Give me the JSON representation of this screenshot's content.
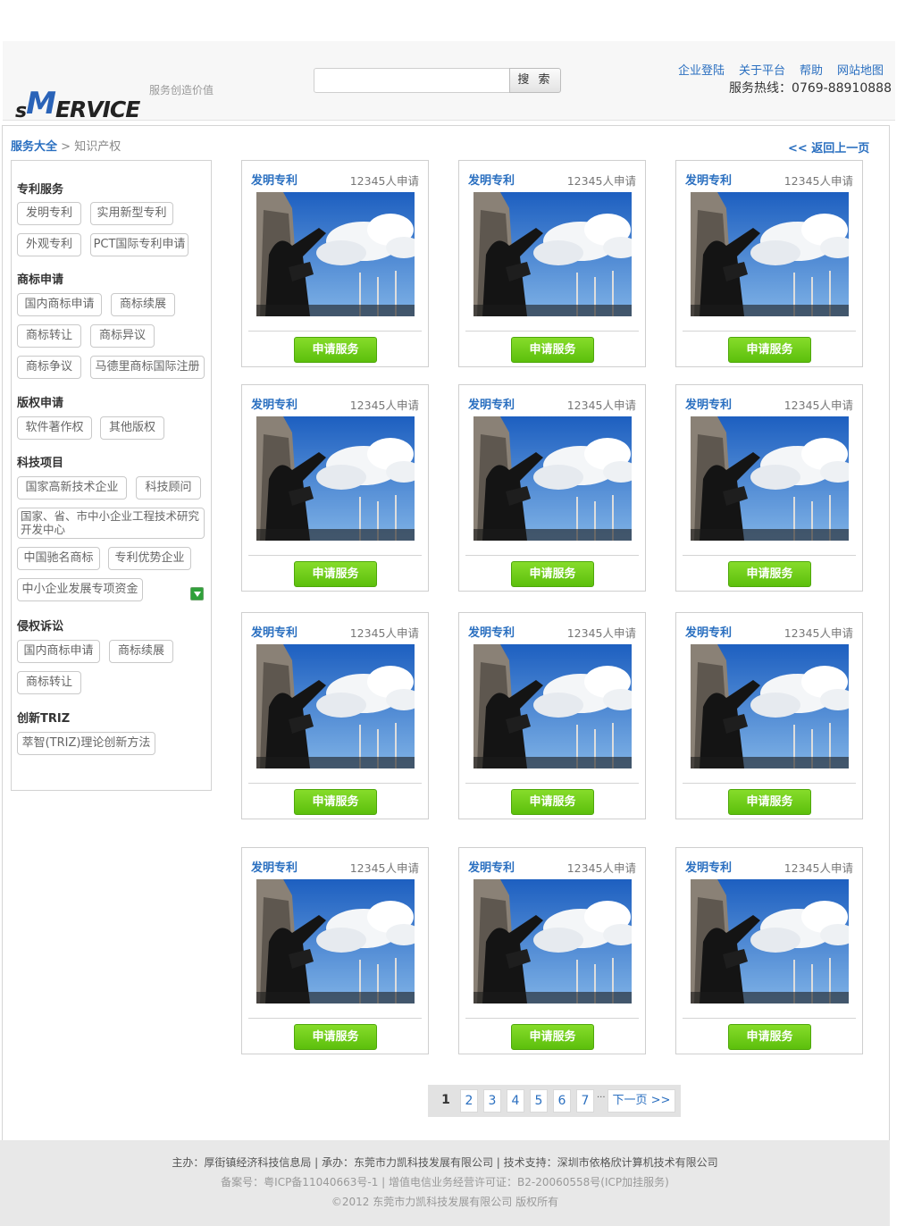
{
  "header": {
    "slogan": "服务创造价值",
    "logo_s": "s",
    "logo_m": "M",
    "logo_rest": "ERVICE",
    "search": {
      "placeholder": "",
      "button_label": "搜 索"
    },
    "links": [
      "企业登陆",
      "关于平台",
      "帮助",
      "网站地图"
    ],
    "hotline": "服务热线：0769-88910888"
  },
  "breadcrumb": {
    "home": "服务大全",
    "separator": " > ",
    "current": "知识产权"
  },
  "back_link": "<< 返回上一页",
  "sidebar": {
    "categories": [
      {
        "title": "专利服务",
        "tags": [
          "发明专利",
          "实用新型专利",
          "外观专利",
          "PCT国际专利申请"
        ]
      },
      {
        "title": "商标申请",
        "tags": [
          "国内商标申请",
          "商标续展",
          "商标转让",
          "商标异议",
          "商标争议",
          "马德里商标国际注册"
        ]
      },
      {
        "title": "版权申请",
        "tags": [
          "软件著作权",
          "其他版权"
        ]
      },
      {
        "title": "科技项目",
        "tags": [
          "国家高新技术企业",
          "科技顾问",
          "国家、省、市中小企业工程技术研究开发中心",
          "中国驰名商标",
          "专利优势企业",
          "中小企业发展专项资金"
        ]
      },
      {
        "title": "侵权诉讼",
        "tags": [
          "国内商标申请",
          "商标续展",
          "商标转让"
        ]
      },
      {
        "title": "创新TRIZ",
        "tags": [
          "萃智(TRIZ)理论创新方法"
        ]
      }
    ]
  },
  "cards": [
    {
      "title": "发明专利",
      "count": "12345人申请",
      "button": "申请服务"
    },
    {
      "title": "发明专利",
      "count": "12345人申请",
      "button": "申请服务"
    },
    {
      "title": "发明专利",
      "count": "12345人申请",
      "button": "申请服务"
    },
    {
      "title": "发明专利",
      "count": "12345人申请",
      "button": "申请服务"
    },
    {
      "title": "发明专利",
      "count": "12345人申请",
      "button": "申请服务"
    },
    {
      "title": "发明专利",
      "count": "12345人申请",
      "button": "申请服务"
    },
    {
      "title": "发明专利",
      "count": "12345人申请",
      "button": "申请服务"
    },
    {
      "title": "发明专利",
      "count": "12345人申请",
      "button": "申请服务"
    },
    {
      "title": "发明专利",
      "count": "12345人申请",
      "button": "申请服务"
    },
    {
      "title": "发明专利",
      "count": "12345人申请",
      "button": "申请服务"
    },
    {
      "title": "发明专利",
      "count": "12345人申请",
      "button": "申请服务"
    },
    {
      "title": "发明专利",
      "count": "12345人申请",
      "button": "申请服务"
    }
  ],
  "pagination": {
    "current": "1",
    "pages": [
      "2",
      "3",
      "4",
      "5",
      "6",
      "7"
    ],
    "ellipsis": "···",
    "next": "下一页 >>"
  },
  "footer": {
    "line1": "主办：厚街镇经济科技信息局 | 承办：东莞市力凯科技发展有限公司 | 技术支持：深圳市依格欣计算机技术有限公司",
    "line2": "备案号：粤ICP备11040663号-1 | 增值电信业务经营许可证：B2-20060558号(ICP加挂服务)",
    "line3": "©2012 东莞市力凯科技发展有限公司 版权所有"
  }
}
